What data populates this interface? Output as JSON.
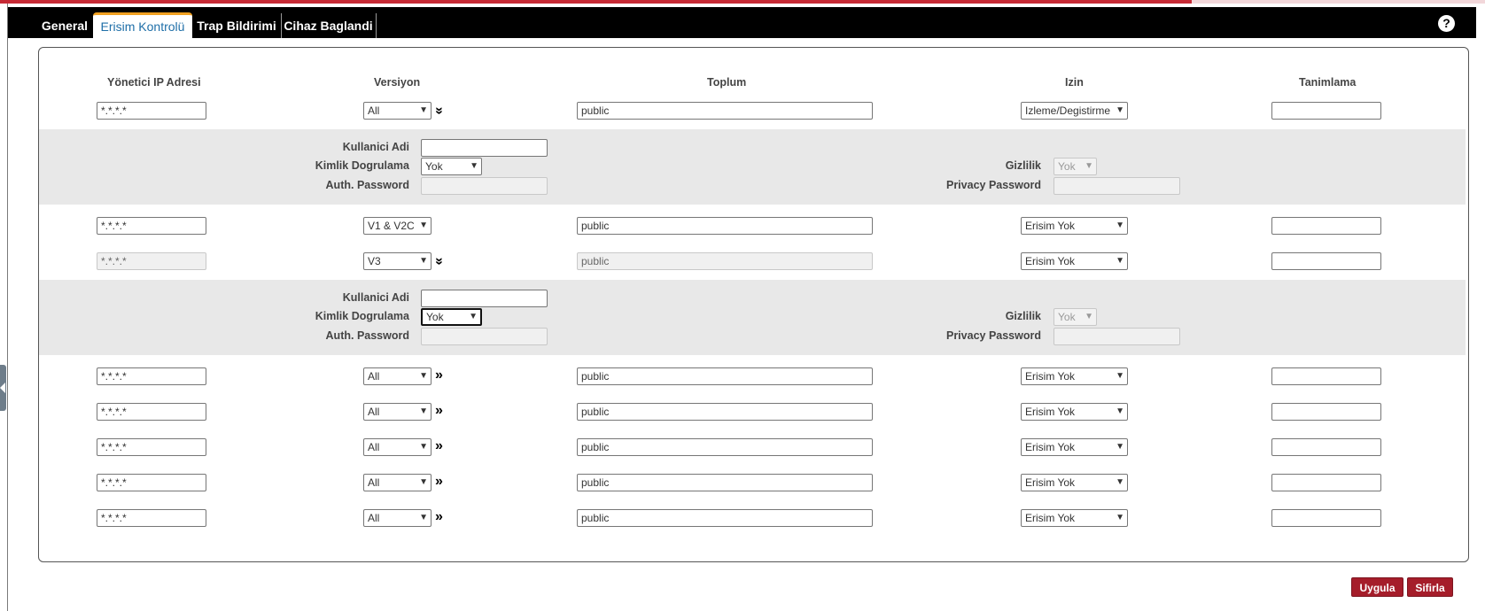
{
  "tabs": [
    "General",
    "Erisim Kontrolü",
    "Trap Bildirimi",
    "Cihaz Baglandi"
  ],
  "help_label": "?",
  "headers": {
    "ip": "Yönetici IP Adresi",
    "version": "Versiyon",
    "community": "Toplum",
    "permission": "Izin",
    "description": "Tanimlama"
  },
  "rows": [
    {
      "ip": "*.*.*.*",
      "version": "All",
      "community": "public",
      "permission": "Izleme/Degistirme",
      "description": "",
      "toggle": "«"
    },
    {
      "ip": "*.*.*.*",
      "version": "V1 & V2C",
      "community": "public",
      "permission": "Erisim Yok",
      "description": ""
    },
    {
      "ip": "*.*.*.*",
      "version": "V3",
      "community": "public",
      "permission": "Erisim Yok",
      "description": "",
      "toggle": "«"
    },
    {
      "ip": "*.*.*.*",
      "version": "All",
      "community": "public",
      "permission": "Erisim Yok",
      "description": "",
      "toggle": "»"
    },
    {
      "ip": "*.*.*.*",
      "version": "All",
      "community": "public",
      "permission": "Erisim Yok",
      "description": "",
      "toggle": "»"
    },
    {
      "ip": "*.*.*.*",
      "version": "All",
      "community": "public",
      "permission": "Erisim Yok",
      "description": "",
      "toggle": "»"
    },
    {
      "ip": "*.*.*.*",
      "version": "All",
      "community": "public",
      "permission": "Erisim Yok",
      "description": "",
      "toggle": "»"
    },
    {
      "ip": "*.*.*.*",
      "version": "All",
      "community": "public",
      "permission": "Erisim Yok",
      "description": "",
      "toggle": "»"
    }
  ],
  "v3": {
    "username_label": "Kullanici Adi",
    "auth_label": "Kimlik Dogrulama",
    "auth_value": "Yok",
    "auth_password_label": "Auth. Password",
    "privacy_label": "Gizlilik",
    "privacy_value": "Yok",
    "privacy_password_label": "Privacy Password"
  },
  "buttons": {
    "apply": "Uygula",
    "reset": "Sifirla"
  },
  "colors": {
    "tabbar": "#000000",
    "active_tab_text": "#1f6fa8",
    "active_tab_accent": "#f0a020",
    "button": "#a51d2a",
    "subpanel": "#e8e8e8"
  }
}
